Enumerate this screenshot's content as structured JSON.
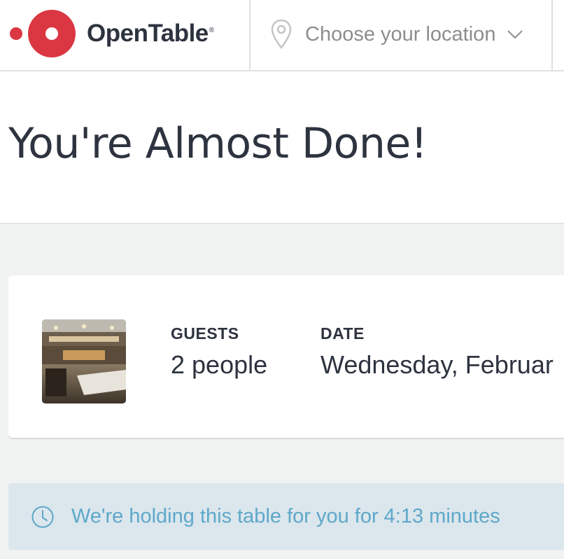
{
  "header": {
    "brand": "OpenTable",
    "brand_mark": "®",
    "location_placeholder": "Choose your location",
    "location_icon": "location-pin-icon",
    "dropdown_icon": "chevron-down-icon"
  },
  "page": {
    "title": "You're Almost Done!"
  },
  "reservation": {
    "photo_icon": "restaurant-photo",
    "guests_label": "GUESTS",
    "guests_value": "2 people",
    "date_label": "DATE",
    "date_value": "Wednesday, Februar"
  },
  "hold": {
    "icon": "clock-icon",
    "message": "We're holding this table for you for 4:13 minutes"
  },
  "colors": {
    "brand_red": "#da3743",
    "hold_text": "#5ea8c9",
    "hold_background": "#dbe6ed",
    "page_background": "#f1f2f2"
  }
}
